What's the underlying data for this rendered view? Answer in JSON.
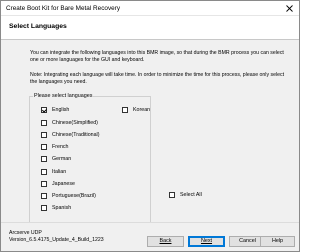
{
  "window": {
    "title": "Create Boot Kit for Bare Metal Recovery"
  },
  "header": {
    "title": "Select Languages"
  },
  "content": {
    "intro": "You can integrate the following languages into this BMR image, so that during the BMR process you can select one or more languages for the GUI and keyboard.",
    "note": "Note: Integrating each language will take time. In order to minimize the time for this process, please only select the languages you need.",
    "group_label": "Please select languages",
    "languages": [
      {
        "label": "English",
        "checked": true
      },
      {
        "label": "Chinese(Simplified)",
        "checked": false
      },
      {
        "label": "Chinese(Traditional)",
        "checked": false
      },
      {
        "label": "French",
        "checked": false
      },
      {
        "label": "German",
        "checked": false
      },
      {
        "label": "Italian",
        "checked": false
      },
      {
        "label": "Japanese",
        "checked": false
      },
      {
        "label": "Portuguese(Brazil)",
        "checked": false
      },
      {
        "label": "Spanish",
        "checked": false
      }
    ],
    "korean": {
      "label": "Korean",
      "checked": false
    },
    "select_all": {
      "label": "Select All",
      "checked": false
    }
  },
  "footer": {
    "product": "Arcserve UDP",
    "version": "Version_6.5.4175_Update_4_Build_1223",
    "back": "Back",
    "next": "Next",
    "cancel": "Cancel",
    "help": "Help"
  }
}
